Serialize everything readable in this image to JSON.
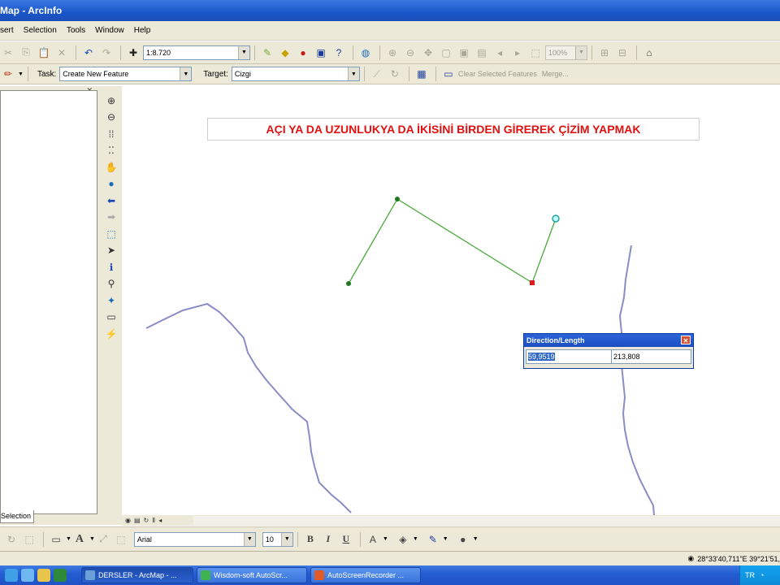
{
  "window": {
    "title": "Map - ArcInfo"
  },
  "menu": [
    "sert",
    "Selection",
    "Tools",
    "Window",
    "Help"
  ],
  "toolbar_standard": {
    "scale": "1:8.720",
    "zoom_percent": "100%"
  },
  "editor_toolbar": {
    "task_label": "Task:",
    "task_value": "Create New Feature",
    "target_label": "Target:",
    "target_value": "Cizgi",
    "clear_selected_label": "Clear Selected Features",
    "merge_label": "Merge..."
  },
  "left_panel": {
    "tab_label": "Selection"
  },
  "map": {
    "banner_text": "AÇI YA DA UZUNLUKYA DA İKİSİNİ BİRDEN GİREREK ÇİZİM YAPMAK",
    "line_color": "#4caa3c",
    "river_color": "#8a8cc4",
    "banner_color": "#e31010"
  },
  "direction_length_dialog": {
    "title": "Direction/Length",
    "direction_value": "59,9519",
    "length_value": "213,808"
  },
  "draw_toolbar": {
    "font_name": "Arial",
    "font_size": "10",
    "bold": "B",
    "italic": "I",
    "underline": "U",
    "text_tool": "A"
  },
  "status_bar": {
    "coordinates": "28°33'40,711\"E  39°21'51,"
  },
  "taskbar": {
    "tasks": [
      {
        "label": "DERSLER - ArcMap - ...",
        "active": true
      },
      {
        "label": "Wisdom-soft AutoScr...",
        "active": false
      },
      {
        "label": "AutoScreenRecorder ...",
        "active": false
      }
    ],
    "tray_lang": "TR"
  }
}
